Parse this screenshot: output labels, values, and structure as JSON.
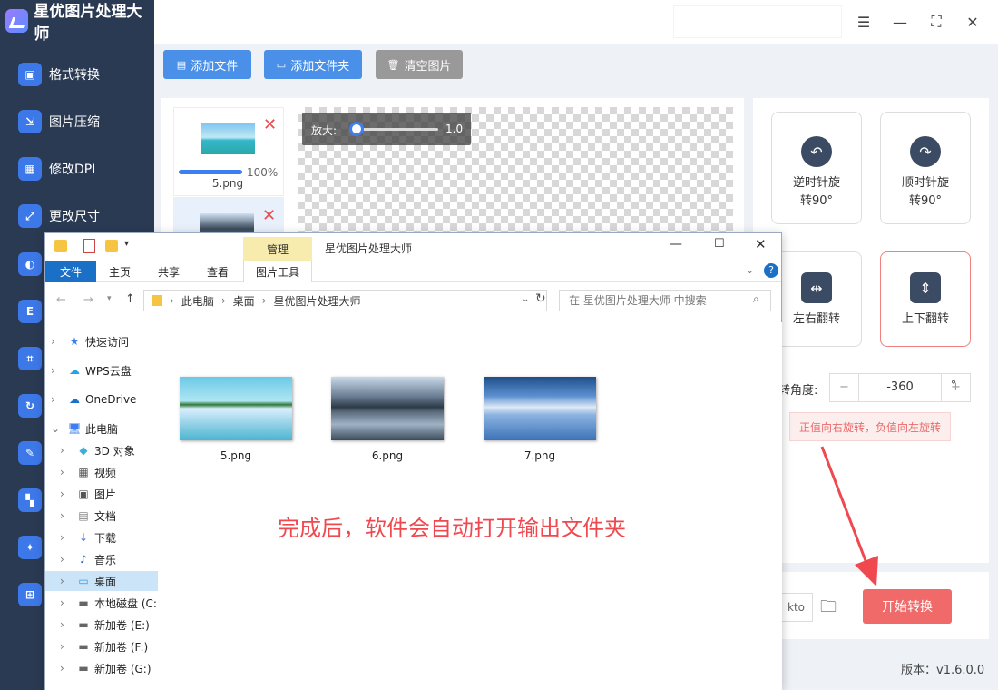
{
  "app": {
    "title": "星优图片处理大师",
    "version": "版本：v1.6.0.0"
  },
  "sidebar": {
    "items": [
      {
        "label": "格式转换",
        "icon": "image-convert-icon"
      },
      {
        "label": "图片压缩",
        "icon": "compress-icon"
      },
      {
        "label": "修改DPI",
        "icon": "dpi-icon"
      },
      {
        "label": "更改尺寸",
        "icon": "resize-icon"
      },
      {
        "label": "",
        "icon": "watermark-icon"
      },
      {
        "label": "",
        "icon": "text-icon"
      },
      {
        "label": "",
        "icon": "crop-icon"
      },
      {
        "label": "",
        "icon": "rotate-icon"
      },
      {
        "label": "",
        "icon": "edit-icon"
      },
      {
        "label": "",
        "icon": "puzzle-icon"
      },
      {
        "label": "",
        "icon": "plugin-icon"
      },
      {
        "label": "",
        "icon": "frame-icon"
      }
    ]
  },
  "toolbar": {
    "add_file": "添加文件",
    "add_folder": "添加文件夹",
    "clear": "清空图片",
    "add_color": "#4a90e8",
    "clear_color": "#999999"
  },
  "thumbs": [
    {
      "name": "5.png",
      "progress": "100%"
    }
  ],
  "zoom": {
    "label": "放大:",
    "value": "1.0"
  },
  "rotate": {
    "ccw": {
      "line1": "逆时针旋",
      "line2": "转90°"
    },
    "cw": {
      "line1": "顺时针旋",
      "line2": "转90°"
    },
    "flip_h": "左右翻转",
    "flip_v": "上下翻转",
    "angle_label": "转角度:",
    "angle_value": "-360",
    "degree": "°",
    "hint": "正值向右旋转，负值向左旋转"
  },
  "output": {
    "path_tail": "kto",
    "start": "开始转换",
    "start_color": "#f06a6a"
  },
  "explorer": {
    "title": "星优图片处理大师",
    "manage_tab": "管理",
    "tabs": [
      "文件",
      "主页",
      "共享",
      "查看",
      "图片工具"
    ],
    "breadcrumb": [
      "此电脑",
      "桌面",
      "星优图片处理大师"
    ],
    "search_placeholder": "在 星优图片处理大师 中搜索",
    "nav": [
      "快速访问",
      "WPS云盘",
      "OneDrive",
      "此电脑",
      "3D 对象",
      "视频",
      "图片",
      "文档",
      "下载",
      "音乐",
      "桌面",
      "本地磁盘 (C:",
      "新加卷 (E:)",
      "新加卷 (F:)",
      "新加卷 (G:)"
    ],
    "files": [
      "5.png",
      "6.png",
      "7.png"
    ]
  },
  "annotation": {
    "message": "完成后，软件会自动打开输出文件夹"
  }
}
